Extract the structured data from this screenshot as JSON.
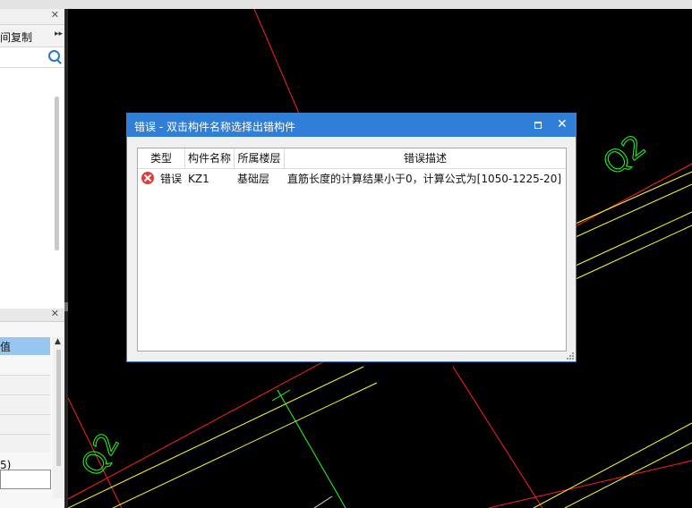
{
  "dialog": {
    "title": "错误 - 双击构件名称选择出错构件",
    "columns": [
      "类型",
      "构件名称",
      "所属楼层",
      "错误描述"
    ],
    "rows": [
      {
        "icon": "error-icon",
        "type": "错误",
        "name": "KZ1",
        "floor": "基础层",
        "desc": "直筋长度的计算结果小于0，计算公式为[1050-1225-20]"
      }
    ]
  },
  "left_panel": {
    "copy_label": "间复制",
    "selected_label": "值",
    "value_fragment": "5)"
  },
  "canvas": {
    "labels": [
      "Q2",
      "Q2"
    ],
    "colors": {
      "red": "#ff2020",
      "yellow": "#ffff30",
      "green": "#20ff20"
    }
  },
  "colors": {
    "titlebar": "#2f7fd8",
    "selection": "#99c6f0",
    "error": "#e23b3b"
  }
}
